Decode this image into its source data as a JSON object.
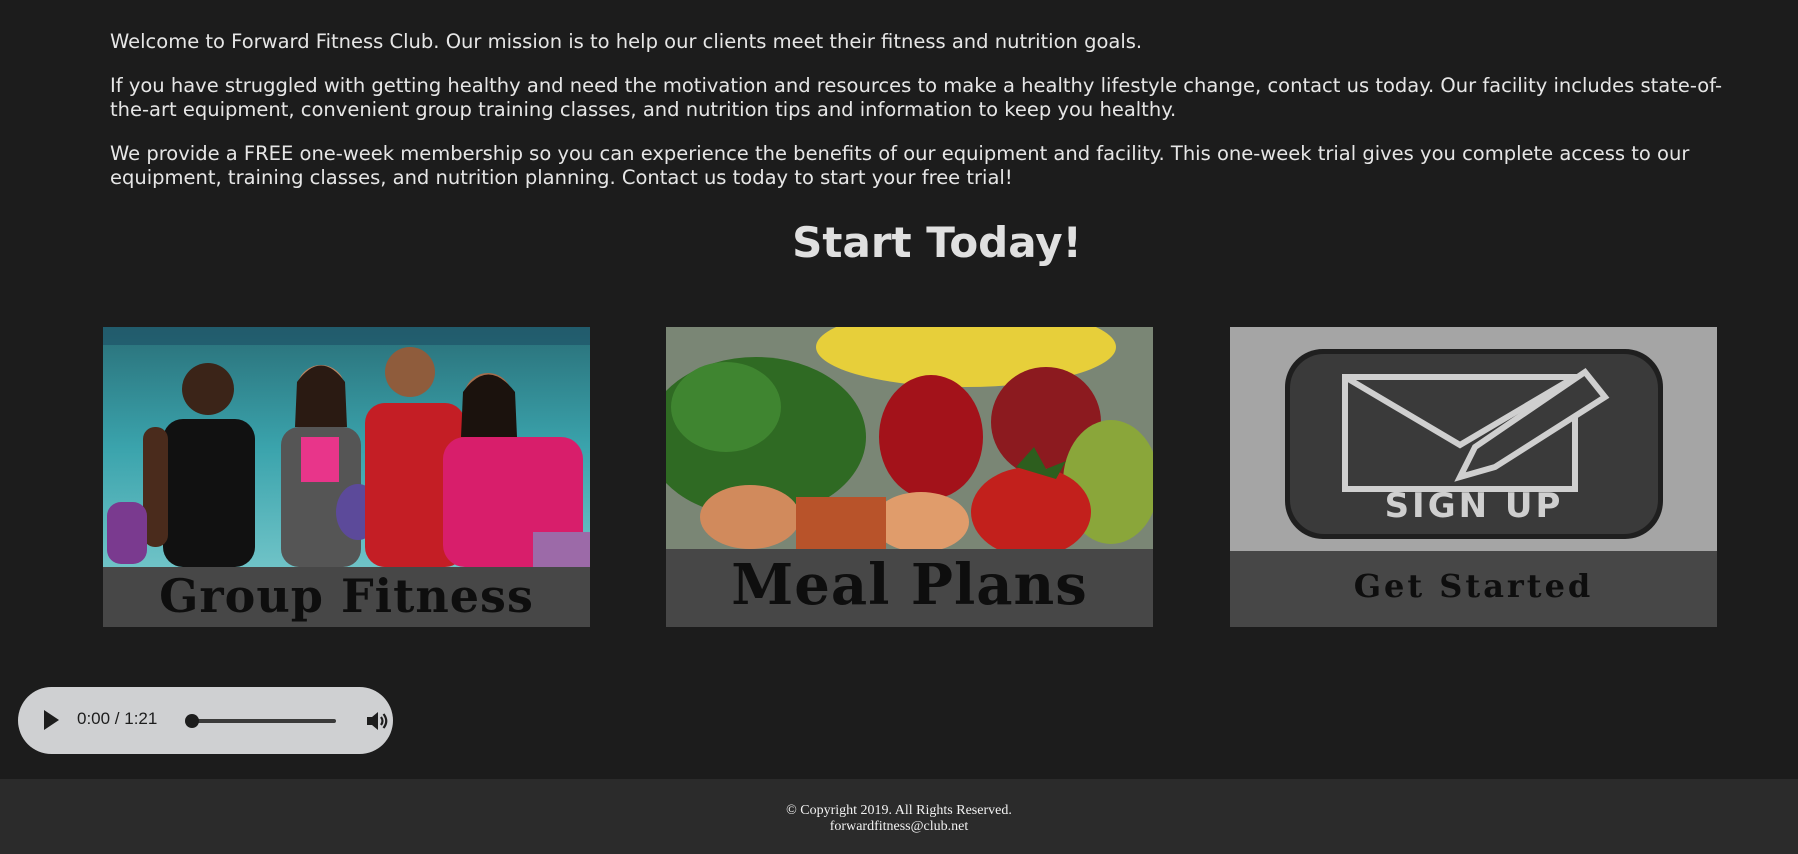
{
  "intro": {
    "p1": "Welcome to Forward Fitness Club. Our mission is to help our clients meet their fitness and nutrition goals.",
    "p2": "If you have struggled with getting healthy and need the motivation and resources to make a healthy lifestyle change, contact us today. Our facility includes state-of-the-art equipment, convenient group training classes, and nutrition tips and information to keep you healthy.",
    "p3": "We provide a FREE one-week membership so you can experience the benefits of our equipment and facility. This one-week trial gives you complete access to our equipment, training classes, and nutrition planning. Contact us today to start your free trial!"
  },
  "cta": {
    "title": "Start Today!"
  },
  "cards": [
    {
      "label": "Group Fitness",
      "image": "group-fitness-people-photo"
    },
    {
      "label": "Meal Plans",
      "image": "fruits-vegetables-photo"
    },
    {
      "label": "Get Started",
      "image": "sign-up-envelope-button",
      "badge_text": "SIGN UP"
    }
  ],
  "audio": {
    "time": "0:00 / 1:21",
    "progress": 0
  },
  "footer": {
    "copyright": "© Copyright 2019. All Rights Reserved.",
    "email": "forwardfitness@club.net"
  },
  "colors": {
    "background": "#1c1c1c",
    "footer": "#2b2b2b",
    "text": "#e6e6e6",
    "card_label_bg": "#474747"
  }
}
